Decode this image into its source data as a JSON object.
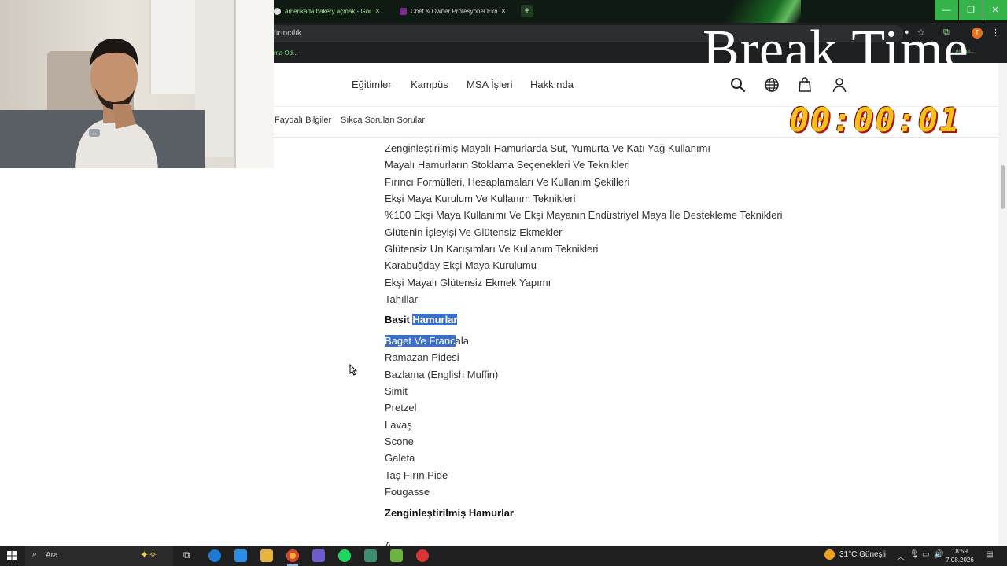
{
  "browser": {
    "tabs": [
      {
        "title": "amerikada bakery açmak - Goo",
        "close": "×"
      },
      {
        "title": "Chef & Owner Profesyonel Ekm",
        "close": "×"
      }
    ],
    "new_tab": "+",
    "window_controls": {
      "minimize": "—",
      "restore": "❐",
      "close": "✕"
    },
    "address": "fırıncılık",
    "bookmarks": [
      "ma Od...",
      "...rin Odi..."
    ],
    "profile_initial": "T"
  },
  "overlay": {
    "break_text": "Break Time",
    "timer": "00:00:01"
  },
  "site": {
    "nav": [
      "Eğitimler",
      "Kampüs",
      "MSA İşleri",
      "Hakkında"
    ],
    "subnav": [
      "Faydalı Bilgiler",
      "Sıkça Sorulan Sorular"
    ]
  },
  "content": {
    "items_top": [
      "Zenginleştirilmiş Mayalı Hamurlarda Süt, Yumurta Ve Katı Yağ Kullanımı",
      "Mayalı Hamurların Stoklama Seçenekleri Ve Teknikleri",
      "Fırıncı Formülleri, Hesaplamaları Ve Kullanım Şekilleri",
      "Ekşi Maya Kurulum Ve Kullanım Teknikleri",
      "%100 Ekşi Maya Kullanımı Ve Ekşi Mayanın Endüstriyel Maya İle Destekleme Teknikleri",
      "Glütenin İşleyişi Ve Glütensiz Ekmekler",
      "Glütensiz Un Karışımları Ve Kullanım Teknikleri",
      "Karabuğday Ekşi Maya Kurulumu",
      "Ekşi Mayalı Glütensiz Ekmek Yapımı",
      "Tahıllar"
    ],
    "heading1_a": "Basit ",
    "heading1_b": "Hamurlar",
    "first_item_selected": "Baget Ve Franc",
    "first_item_rest": "ala",
    "items_basic": [
      "Ramazan Pidesi",
      "Bazlama (English Muffin)",
      "Simit",
      "Pretzel",
      "Lavaş",
      "Scone",
      "Galeta",
      "Taş Fırın Pide",
      "Fougasse"
    ],
    "heading2": "Zenginleştirilmiş Hamurlar",
    "cut_off": "A"
  },
  "taskbar": {
    "search_placeholder": "Ara",
    "weather": "31°C  Güneşli",
    "time": "18:59",
    "date": "7.08.2026"
  }
}
